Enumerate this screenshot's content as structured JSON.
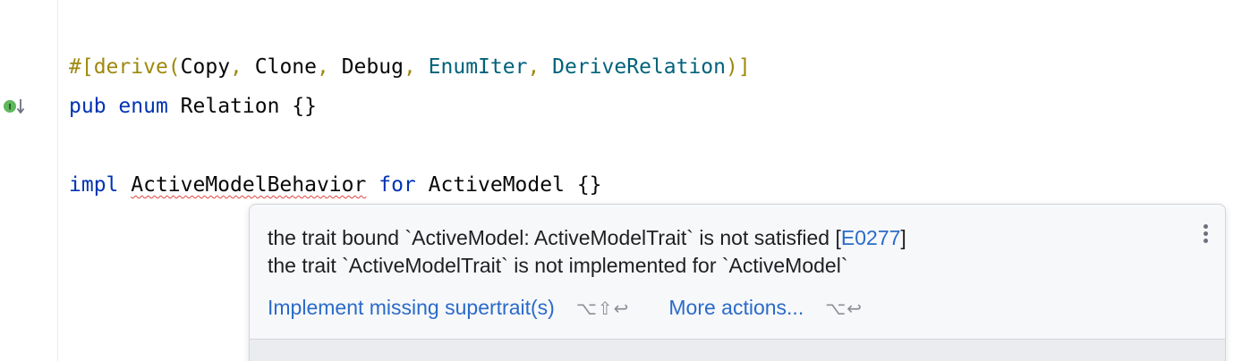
{
  "code": {
    "line1": {
      "hash": "#[",
      "derive": "derive",
      "open": "(",
      "copy": "Copy",
      "comma1": ", ",
      "clone": "Clone",
      "comma2": ", ",
      "debug": "Debug",
      "comma3": ", ",
      "enumiter": "EnumIter",
      "comma4": ", ",
      "deriverelation": "DeriveRelation",
      "close": ")]"
    },
    "line2": {
      "pub": "pub",
      "enum": "enum",
      "name": "Relation",
      "body": "{}"
    },
    "line3": {
      "impl": "impl",
      "trait": "ActiveModelBehavior",
      "for": "for",
      "type": "ActiveModel",
      "body": "{}"
    }
  },
  "gutter": {
    "marker_label": "I",
    "marker_icon": "implemented-marker-icon"
  },
  "popup": {
    "message_line1_prefix": "the trait bound `ActiveModel: ActiveModelTrait` is not satisfied [",
    "error_code": "E0277",
    "message_line1_suffix": "]",
    "message_line2": "the trait `ActiveModelTrait` is not implemented for `ActiveModel`",
    "action1_label": "Implement missing supertrait(s)",
    "action1_shortcut": "⌥⇧↩",
    "action2_label": "More actions...",
    "action2_shortcut": "⌥↩",
    "menu_icon": "kebab-menu-icon"
  },
  "colors": {
    "keyword": "#0033b3",
    "attribute": "#9e880d",
    "macro": "#00627a",
    "link": "#2a6bc9",
    "error_underline": "#e0443e"
  }
}
